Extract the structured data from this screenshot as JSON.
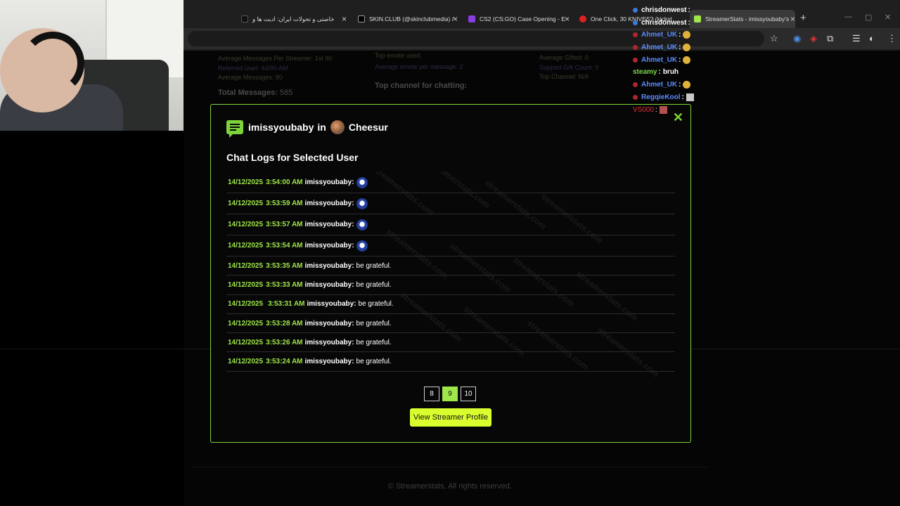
{
  "browser": {
    "tabs": [
      {
        "label": "خاصتی و تحولات ایران: ادیت ها و",
        "icon": "tiktok-icon"
      },
      {
        "label": "SKIN.CLUB (@skinclubmedia) /",
        "icon": "x-icon"
      },
      {
        "label": "CS2 (CS:GO) Case Opening - E",
        "icon": "skin-icon"
      },
      {
        "label": "One Click, 30 KNIVES? (kickst",
        "icon": "youtube-icon"
      },
      {
        "label": "StreamerStats - imissyoubaby's",
        "icon": "streamerstats-icon"
      }
    ],
    "new_tab": "+"
  },
  "background_page": {
    "col1": [
      "Average Messages Per Streamer: 1st 90",
      "Referred User: 44/90 AM",
      "Average Messages: 80"
    ],
    "total_messages_label": "Total Messages:",
    "total_messages_value": "585",
    "col2": [
      "Top emote used:",
      "Average emote per message: 2"
    ],
    "top_channel_label": "Top channel for chatting:",
    "col3": [
      "Average Gifted: 0",
      "Support Gift Count: 0",
      "Top Channel: N/A"
    ],
    "footer": "© Streamerstats, All rights reserved."
  },
  "chat_overlay": [
    {
      "user": "chrisdonwest",
      "color": "#ffffff",
      "msg": ""
    },
    {
      "user": "chrisdonwest",
      "color": "#ffffff",
      "msg": ""
    },
    {
      "user": "Ahmet_UK",
      "color": "#5b8cff",
      "msg": ""
    },
    {
      "user": "Ahmet_UK",
      "color": "#5b8cff",
      "msg": ""
    },
    {
      "user": "Ahmet_UK",
      "color": "#5b8cff",
      "msg": ""
    },
    {
      "user": "steamy",
      "color": "#7ad34a",
      "msg": "bruh"
    },
    {
      "user": "Ahmet_UK",
      "color": "#5b8cff",
      "msg": ""
    },
    {
      "user": "RegqieKool",
      "color": "#5b8cff",
      "msg": ""
    },
    {
      "user": "VS000",
      "color": "#e0303a",
      "msg": ""
    }
  ],
  "modal": {
    "username": "imissyoubaby",
    "in_word": "in",
    "channel": "Cheesur",
    "title": "Chat Logs for Selected User",
    "close": "✕",
    "logs": [
      {
        "date": "14/12/2025",
        "time": "3:54:00 AM",
        "user": "imissyoubaby:",
        "msg": "",
        "emote": true
      },
      {
        "date": "14/12/2025",
        "time": "3:53:59 AM",
        "user": "imissyoubaby:",
        "msg": "",
        "emote": true
      },
      {
        "date": "14/12/2025",
        "time": "3:53:57 AM",
        "user": "imissyoubaby:",
        "msg": "",
        "emote": true
      },
      {
        "date": "14/12/2025",
        "time": "3:53:54 AM",
        "user": "imissyoubaby:",
        "msg": "",
        "emote": true
      },
      {
        "date": "14/12/2025",
        "time": "3:53:35 AM",
        "user": "imissyoubaby:",
        "msg": "be grateful.",
        "emote": false
      },
      {
        "date": "14/12/2025",
        "time": "3:53:33 AM",
        "user": "imissyoubaby:",
        "msg": "be grateful.",
        "emote": false
      },
      {
        "date": "14/12/2025",
        "time": "3:53:31 AM",
        "user": "imissyoubaby:",
        "msg": "be grateful.",
        "emote": false
      },
      {
        "date": "14/12/2025",
        "time": "3:53:28 AM",
        "user": "imissyoubaby:",
        "msg": "be grateful.",
        "emote": false
      },
      {
        "date": "14/12/2025",
        "time": "3:53:26 AM",
        "user": "imissyoubaby:",
        "msg": "be grateful.",
        "emote": false
      },
      {
        "date": "14/12/2025",
        "time": "3:53:24 AM",
        "user": "imissyoubaby:",
        "msg": "be grateful.",
        "emote": false
      }
    ],
    "pages": [
      {
        "label": "8",
        "active": false
      },
      {
        "label": "9",
        "active": true
      },
      {
        "label": "10",
        "active": false
      }
    ],
    "view_button": "View Streamer Profile",
    "watermark": "streamerstats.com"
  },
  "colors": {
    "accent": "#7cd43a",
    "button": "#d9ff2f",
    "date": "#9fe64a"
  }
}
